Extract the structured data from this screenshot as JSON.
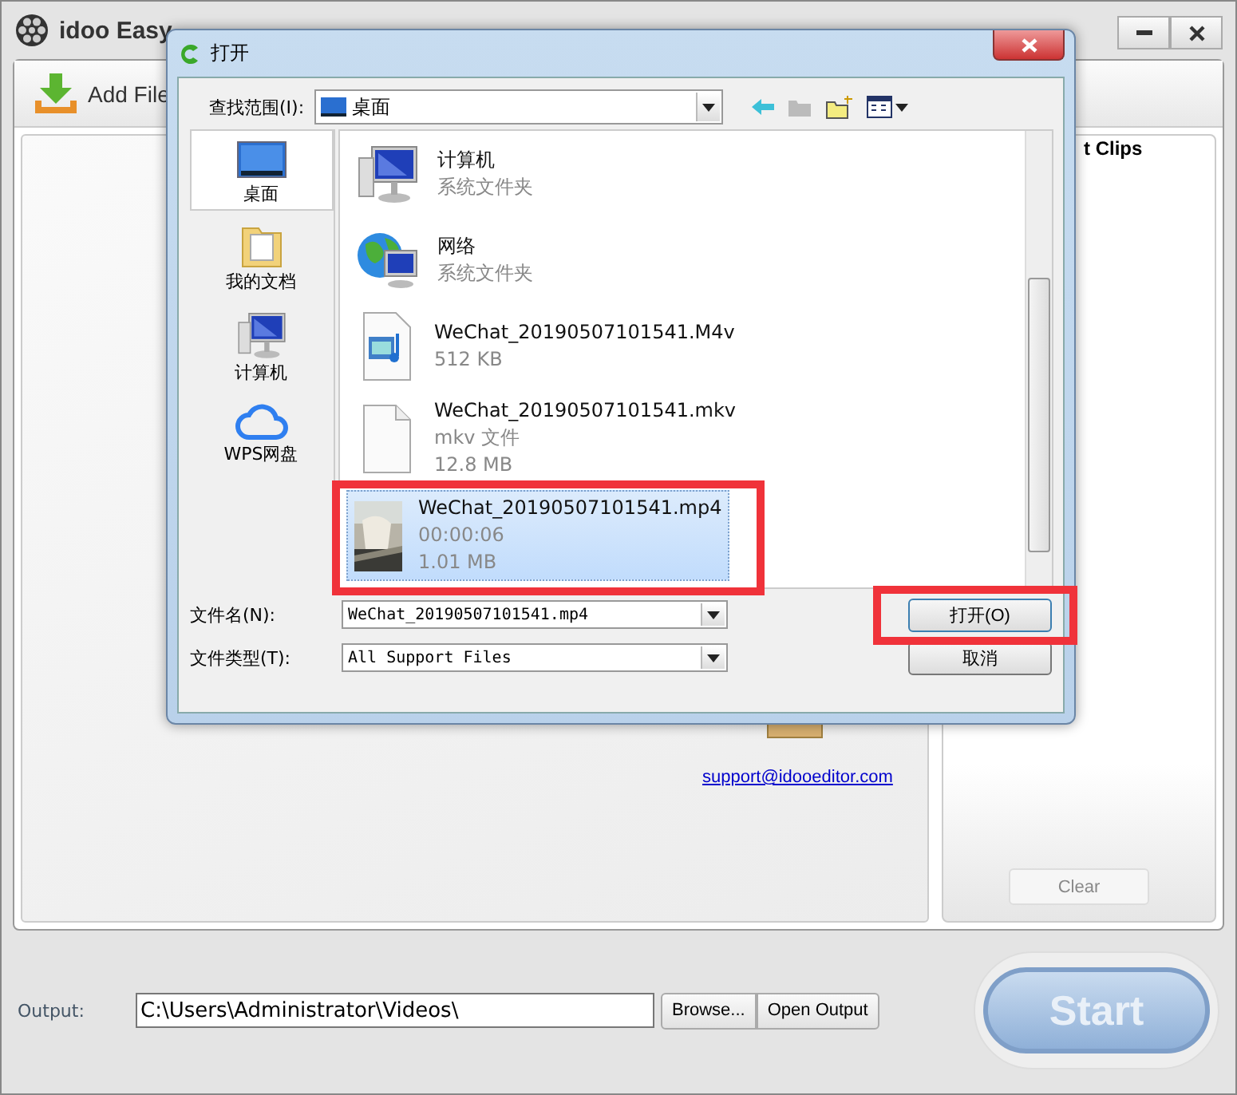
{
  "main_window": {
    "title": "idoo Easy",
    "add_file": "Add File",
    "clips_header": "t Clips",
    "clear_button": {
      "label": "Clear",
      "disabled": true
    },
    "support_link": "support@idooeditor.com",
    "output_label": "Output:",
    "output_path": "C:\\Users\\Administrator\\Videos\\",
    "browse_button": "Browse...",
    "open_output_button": "Open Output",
    "start_button": "Start"
  },
  "dialog": {
    "title": "打开",
    "look_in_label": "查找范围(I):",
    "look_in_value": "桌面",
    "places": [
      {
        "label": "桌面",
        "kind": "desktop",
        "selected": true
      },
      {
        "label": "我的文档",
        "kind": "folder",
        "selected": false
      },
      {
        "label": "计算机",
        "kind": "computer",
        "selected": false
      },
      {
        "label": "WPS网盘",
        "kind": "cloud",
        "selected": false
      }
    ],
    "files": [
      {
        "name": "计算机",
        "details": [
          "系统文件夹"
        ],
        "kind": "computer",
        "selected": false,
        "highlighted": false
      },
      {
        "name": "网络",
        "details": [
          "系统文件夹"
        ],
        "kind": "network",
        "selected": false,
        "highlighted": false
      },
      {
        "name": "WeChat_20190507101541.M4v",
        "details": [
          "512 KB"
        ],
        "kind": "media",
        "selected": false,
        "highlighted": false
      },
      {
        "name": "WeChat_20190507101541.mkv",
        "details": [
          "mkv 文件",
          "12.8 MB"
        ],
        "kind": "blank",
        "selected": false,
        "highlighted": false
      },
      {
        "name": "WeChat_20190507101541.mp4",
        "details": [
          "00:00:06",
          "1.01 MB"
        ],
        "kind": "thumbnail",
        "selected": true,
        "highlighted": true
      }
    ],
    "filename_label": "文件名(N):",
    "filename_value": "WeChat_20190507101541.mp4",
    "filetype_label": "文件类型(T):",
    "filetype_value": "All Support Files",
    "open_button": {
      "label": "打开(O)",
      "highlighted": true
    },
    "cancel_button": "取消"
  }
}
